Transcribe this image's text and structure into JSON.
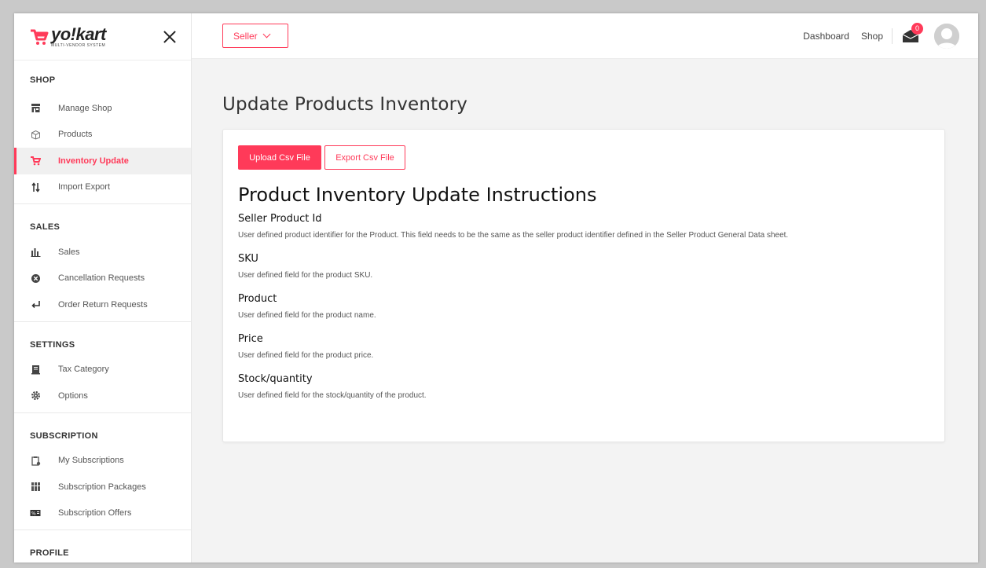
{
  "brand": {
    "name": "yo!kart",
    "tagline": "MULTI-VENDOR SYSTEM"
  },
  "header": {
    "role_dropdown": "Seller",
    "links": [
      "Dashboard",
      "Shop"
    ],
    "message_count": "0",
    "colors": {
      "accent": "#ff3a59"
    }
  },
  "sidebar": {
    "sections": [
      {
        "title": "SHOP",
        "items": [
          {
            "label": "Manage Shop",
            "icon": "storefront-icon",
            "active": false
          },
          {
            "label": "Products",
            "icon": "box-icon",
            "active": false
          },
          {
            "label": "Inventory Update",
            "icon": "cart-icon",
            "active": true
          },
          {
            "label": "Import Export",
            "icon": "arrows-updown-icon",
            "active": false
          }
        ]
      },
      {
        "title": "SALES",
        "items": [
          {
            "label": "Sales",
            "icon": "bar-chart-icon",
            "active": false
          },
          {
            "label": "Cancellation Requests",
            "icon": "cancel-circle-icon",
            "active": false
          },
          {
            "label": "Order Return Requests",
            "icon": "return-arrow-icon",
            "active": false
          }
        ]
      },
      {
        "title": "SETTINGS",
        "items": [
          {
            "label": "Tax Category",
            "icon": "receipt-icon",
            "active": false
          },
          {
            "label": "Options",
            "icon": "gear-icon",
            "active": false
          }
        ]
      },
      {
        "title": "SUBSCRIPTION",
        "items": [
          {
            "label": "My Subscriptions",
            "icon": "clipboard-icon",
            "active": false
          },
          {
            "label": "Subscription Packages",
            "icon": "package-icon",
            "active": false
          },
          {
            "label": "Subscription Offers",
            "icon": "percent-tag-icon",
            "active": false
          }
        ]
      },
      {
        "title": "PROFILE",
        "items": []
      }
    ]
  },
  "main": {
    "page_title": "Update Products Inventory",
    "buttons": {
      "upload": "Upload Csv File",
      "export": "Export Csv File"
    },
    "instructions_title": "Product Inventory Update Instructions",
    "fields": [
      {
        "name": "Seller Product Id",
        "desc": "User defined product identifier for the Product. This field needs to be the same as the seller product identifier defined in the Seller Product General Data sheet."
      },
      {
        "name": "SKU",
        "desc": "User defined field for the product SKU."
      },
      {
        "name": "Product",
        "desc": "User defined field for the product name."
      },
      {
        "name": "Price",
        "desc": "User defined field for the product price."
      },
      {
        "name": "Stock/quantity",
        "desc": "User defined field for the stock/quantity of the product."
      }
    ]
  }
}
